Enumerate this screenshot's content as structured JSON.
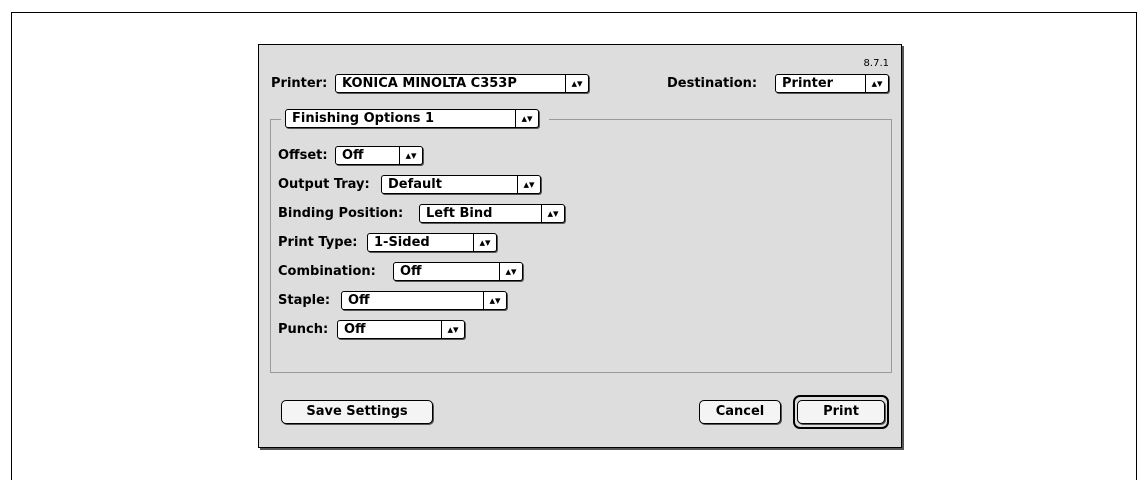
{
  "version": "8.7.1",
  "printer": {
    "label": "Printer:",
    "value": "KONICA MINOLTA C353P"
  },
  "destination": {
    "label": "Destination:",
    "value": "Printer"
  },
  "panel": {
    "value": "Finishing Options 1"
  },
  "options": [
    {
      "label": "Offset:",
      "value": "Off"
    },
    {
      "label": "Output Tray:",
      "value": "Default"
    },
    {
      "label": "Binding Position:",
      "value": "Left Bind"
    },
    {
      "label": "Print Type:",
      "value": "1-Sided"
    },
    {
      "label": "Combination:",
      "value": "Off"
    },
    {
      "label": "Staple:",
      "value": "Off"
    },
    {
      "label": "Punch:",
      "value": "Off"
    }
  ],
  "buttons": {
    "save": "Save Settings",
    "cancel": "Cancel",
    "print": "Print"
  },
  "icons": {
    "popup_arrow": "up-down-arrows-icon"
  }
}
